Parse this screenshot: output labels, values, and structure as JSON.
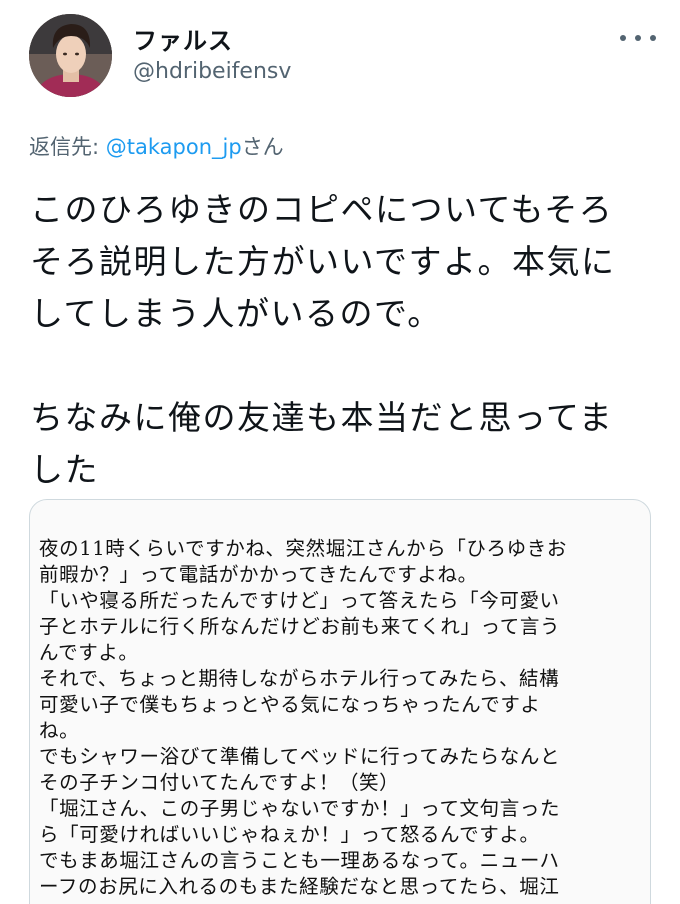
{
  "user": {
    "display_name": "ファルス",
    "handle": "@hdribeifensv"
  },
  "reply": {
    "prefix": "返信先: ",
    "mention": "@takapon_jp",
    "suffix": "さん"
  },
  "tweet": {
    "lines": [
      "このひろゆきのコピペについてもそろ",
      "そろ説明した方がいいですよ。本気に",
      "してしまう人がいるので。",
      "",
      "ちなみに俺の友達も本当だと思ってま",
      "した"
    ]
  },
  "media": {
    "lines": [
      "夜の11時くらいですかね、突然堀江さんから「ひろゆきお",
      "前暇か？」って電話がかかってきたんですよね。",
      "「いや寝る所だったんですけど」って答えたら「今可愛い",
      "子とホテルに行く所なんだけどお前も来てくれ」って言う",
      "んですよ。",
      "それで、ちょっと期待しながらホテル行ってみたら、結構",
      "可愛い子で僕もちょっとやる気になっちゃったんですよ",
      "ね。",
      "でもシャワー浴びて準備してベッドに行ってみたらなんと",
      "その子チンコ付いてたんですよ！（笑）",
      "「堀江さん、この子男じゃないですか！」って文句言った",
      "ら「可愛ければいいじゃねぇか！」って怒るんですよ。",
      "でもまあ堀江さんの言うことも一理あるなって。ニューハ",
      "ーフのお尻に入れるのもまた経験だなと思ってたら、堀江"
    ]
  },
  "colors": {
    "text": "#0f1419",
    "secondary": "#536471",
    "accent": "#1d9bf0",
    "border": "#cfd9de"
  },
  "icons": {
    "more": "more-horizontal-icon"
  }
}
